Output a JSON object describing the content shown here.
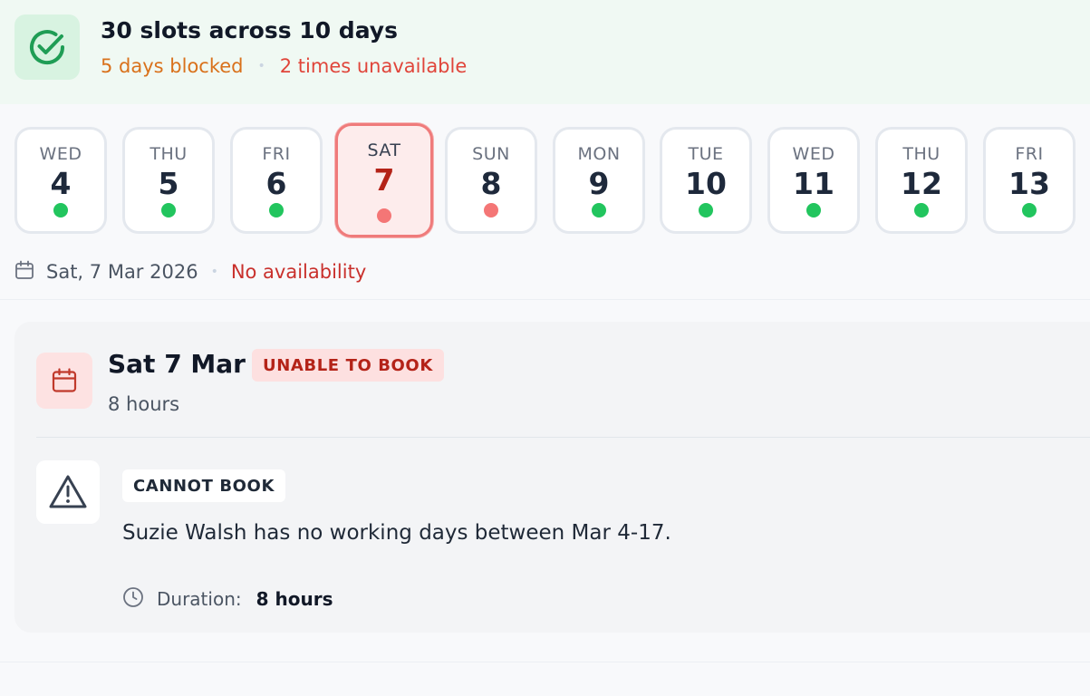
{
  "summary": {
    "title": "30 slots across 10 days",
    "blocked": "5 days blocked",
    "separator": "•",
    "unavailable": "2 times unavailable",
    "icon": "check-circle-icon"
  },
  "days": [
    {
      "dow": "WED",
      "num": "4",
      "status": "available"
    },
    {
      "dow": "THU",
      "num": "5",
      "status": "available"
    },
    {
      "dow": "FRI",
      "num": "6",
      "status": "available"
    },
    {
      "dow": "SAT",
      "num": "7",
      "status": "unavailable",
      "selected": true
    },
    {
      "dow": "SUN",
      "num": "8",
      "status": "unavailable"
    },
    {
      "dow": "MON",
      "num": "9",
      "status": "available"
    },
    {
      "dow": "TUE",
      "num": "10",
      "status": "available"
    },
    {
      "dow": "WED",
      "num": "11",
      "status": "available"
    },
    {
      "dow": "THU",
      "num": "12",
      "status": "available"
    },
    {
      "dow": "FRI",
      "num": "13",
      "status": "available"
    }
  ],
  "selected_date": {
    "text": "Sat, 7 Mar 2026",
    "separator": "•",
    "status": "No availability"
  },
  "detail": {
    "title": "Sat 7 Mar",
    "badge": "UNABLE TO BOOK",
    "subtitle": "8 hours",
    "issue": {
      "badge": "CANNOT BOOK",
      "message": "Suzie Walsh has no working days between Mar 4-17.",
      "duration_label": "Duration:",
      "duration_value": "8 hours"
    }
  },
  "colors": {
    "available": "#22c55e",
    "unavailable": "#f47676",
    "accent_red": "#b42318",
    "accent_orange": "#d9711b"
  }
}
